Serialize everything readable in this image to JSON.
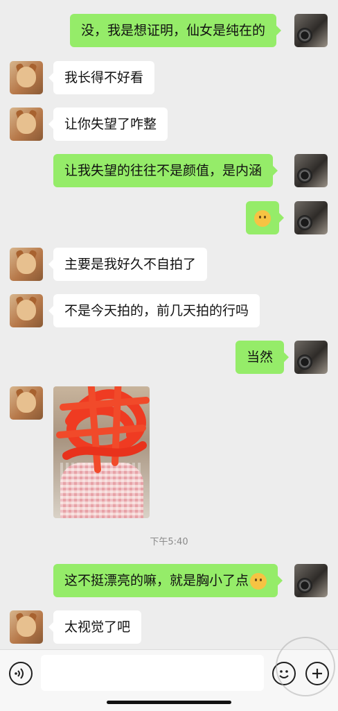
{
  "colors": {
    "outgoing_bubble": "#95ec69",
    "incoming_bubble": "#ffffff",
    "chat_background": "#ededed"
  },
  "contact": {
    "avatar_icon": "shiba-dog-avatar"
  },
  "self": {
    "avatar_icon": "camera-avatar"
  },
  "messages": [
    {
      "from": "self",
      "text": "没，我是想证明，仙女是纯在的"
    },
    {
      "from": "contact",
      "text": "我长得不好看"
    },
    {
      "from": "contact",
      "text": "让你失望了咋整"
    },
    {
      "from": "self",
      "text": "让我失望的往往不是颜值，是内涵"
    },
    {
      "from": "self",
      "emoji": "hug-emoji"
    },
    {
      "from": "contact",
      "text": "主要是我好久不自拍了"
    },
    {
      "from": "contact",
      "text": "不是今天拍的，前几天拍的行吗"
    },
    {
      "from": "self",
      "text": "当然"
    },
    {
      "from": "contact",
      "image": "selfie-photo-redacted"
    },
    {
      "from": "self",
      "text": "这不挺漂亮的嘛，就是胸小了点",
      "emoji": "thinking-emoji"
    },
    {
      "from": "contact",
      "text": "太视觉了吧"
    }
  ],
  "timestamp": "下午5:40",
  "input_bar": {
    "voice_icon": "voice-icon",
    "emoji_icon": "emoji-icon",
    "plus_icon": "plus-icon"
  }
}
